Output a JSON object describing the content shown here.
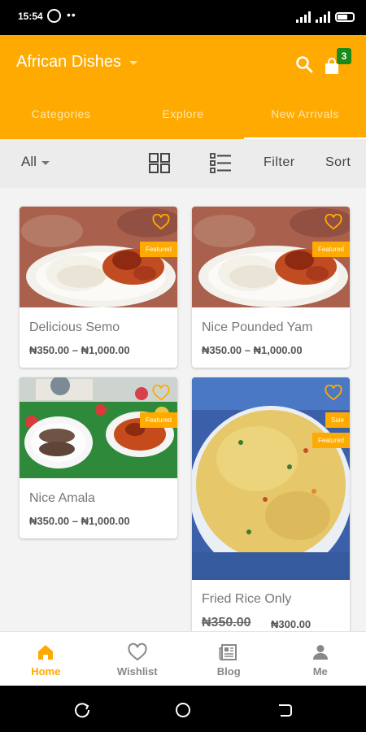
{
  "status_bar": {
    "time": "15:54",
    "dots": "••"
  },
  "app_bar": {
    "title": "African Dishes",
    "cart_count": "3",
    "tabs": [
      {
        "label": "Categories"
      },
      {
        "label": "Explore"
      },
      {
        "label": "New Arrivals"
      }
    ],
    "active_tab": "New Arrivals"
  },
  "filter_bar": {
    "category": "All",
    "filter_label": "Filter",
    "sort_label": "Sort"
  },
  "products": [
    {
      "name": "Delicious Semo",
      "price": "₦350.00 – ₦1,000.00",
      "badges": [
        "Featured"
      ]
    },
    {
      "name": "Nice Pounded Yam",
      "price": "₦350.00 – ₦1,000.00",
      "badges": [
        "Featured"
      ]
    },
    {
      "name": "Nice Amala",
      "price": "₦350.00 – ₦1,000.00",
      "badges": [
        "Featured"
      ]
    },
    {
      "name": "Fried Rice Only",
      "old_price": "₦350.00",
      "new_price": "₦300.00",
      "badges": [
        "Sale",
        "Featured"
      ]
    }
  ],
  "bottom_nav": [
    {
      "label": "Home",
      "icon": "home-icon"
    },
    {
      "label": "Wishlist",
      "icon": "heart-icon"
    },
    {
      "label": "Blog",
      "icon": "newspaper-icon"
    },
    {
      "label": "Me",
      "icon": "person-icon"
    }
  ],
  "colors": {
    "accent": "#ffaa00",
    "badge_green": "#1a8a18",
    "filter_bar_bg": "#ececec"
  }
}
